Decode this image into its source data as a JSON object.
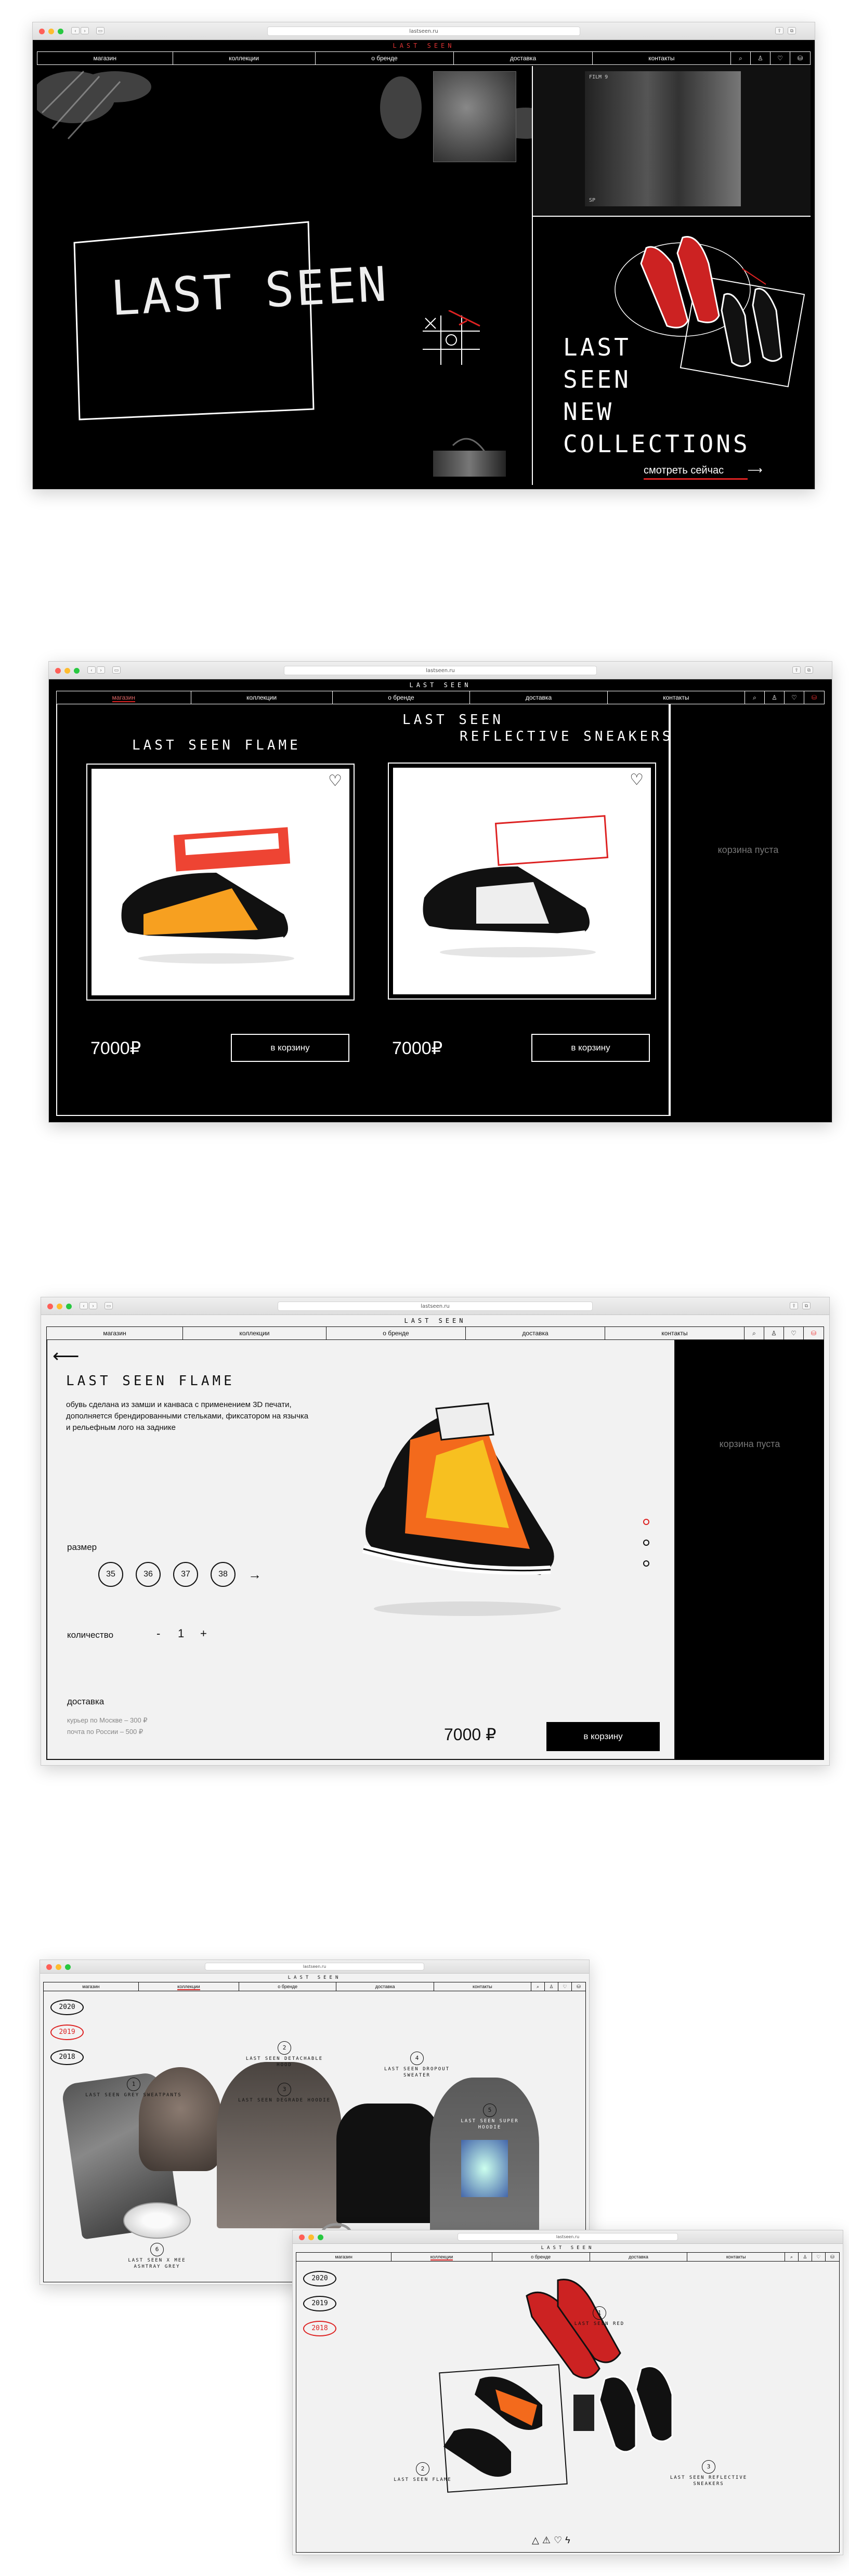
{
  "browser": {
    "url": "lastseen.ru"
  },
  "brand": "LAST SEEN",
  "nav": {
    "shop": "магазин",
    "collections": "коллекции",
    "about": "о бренде",
    "delivery": "доставка",
    "contacts": "контакты"
  },
  "hero": {
    "logo": "LAST SEEN",
    "video_top_label": "FILM 9",
    "video_bottom_label": "SP",
    "promo_lines": [
      "LAST",
      "SEEN",
      "NEW",
      "COLLECTIONS"
    ],
    "cta": "смотреть сейчас"
  },
  "catalog": {
    "products": [
      {
        "title": "LAST SEEN FLAME",
        "price": "7000₽",
        "button": "в корзину"
      },
      {
        "title_line1": "LAST SEEN",
        "title_line2": "REFLECTIVE SNEAKERS",
        "price": "7000₽",
        "button": "в корзину"
      }
    ],
    "cart_empty": "корзина пуста"
  },
  "product": {
    "title": "LAST SEEN FLAME",
    "description": "обувь сделана из замши и канваса с применением 3D печати, дополняется брендированными стельками, фиксатором на язычка и рельефным лого на заднике",
    "size_label": "размер",
    "sizes": [
      "35",
      "36",
      "37",
      "38"
    ],
    "qty_label": "количество",
    "qty_minus": "-",
    "qty_value": "1",
    "qty_plus": "+",
    "delivery_label": "доставка",
    "delivery_moscow": "курьер по Москве – 300 ₽",
    "delivery_russia": "почта по России – 500 ₽",
    "price": "7000 ₽",
    "button": "в корзину",
    "cart_empty": "корзина пуста"
  },
  "lookbook_a": {
    "years": [
      "2020",
      "2019",
      "2018"
    ],
    "items": [
      {
        "num": "1",
        "label": "LAST SEEN GREY SWEATPANTS"
      },
      {
        "num": "2",
        "label": "LAST SEEN DETACHABLE HOOD"
      },
      {
        "num": "3",
        "label": "LAST SEEN DEGRADE HOODIE"
      },
      {
        "num": "4",
        "label": "LAST SEEN DROPOUT SWEATER"
      },
      {
        "num": "5",
        "label": "LAST SEEN SUPER HOODIE"
      },
      {
        "num": "6",
        "label": "LAST SEEN X MEE ASHTRAY GREY"
      }
    ]
  },
  "lookbook_b": {
    "years": [
      "2020",
      "2019",
      "2018"
    ],
    "items": [
      {
        "num": "1",
        "label": "LAST SEEN RED"
      },
      {
        "num": "2",
        "label": "LAST SEEN FLAME"
      },
      {
        "num": "3",
        "label": "LAST SEEN REFLECTIVE SNEAKERS"
      }
    ]
  }
}
